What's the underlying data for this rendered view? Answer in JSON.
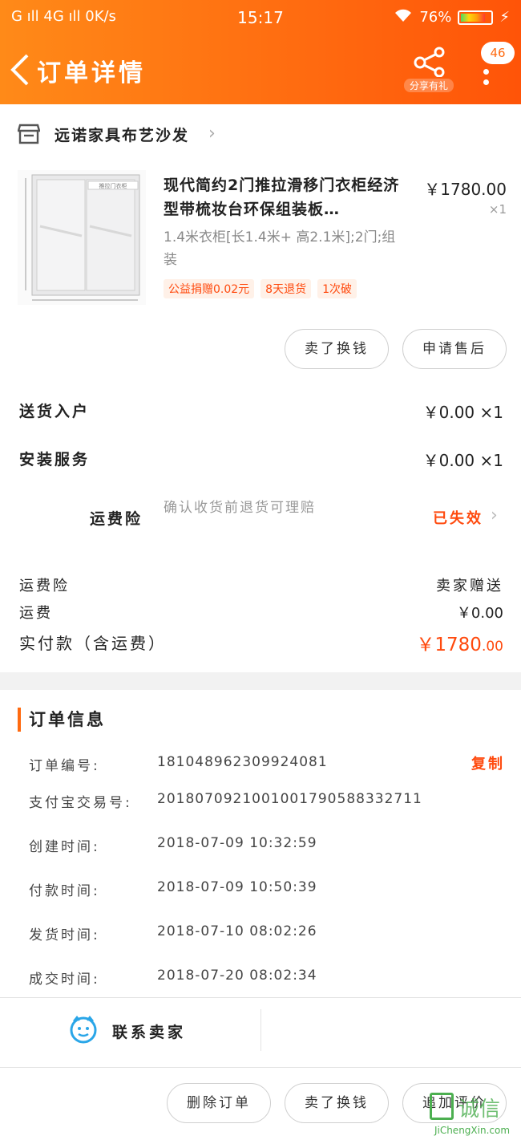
{
  "status_bar": {
    "left": "G ıll 4G ıll 0K/s",
    "time": "15:17",
    "battery": "76%"
  },
  "nav": {
    "title": "订单详情",
    "share_label": "分享有礼",
    "message_count": "46"
  },
  "shop": {
    "name": "远诺家具布艺沙发",
    "chevron": "›"
  },
  "product": {
    "title": "现代简约2门推拉滑移门衣柜经济型带梳妆台环保组装板…",
    "price": "￥1780.00",
    "qty": "×1",
    "spec": "1.4米衣柜[长1.4米+ 高2.1米];2门;组装",
    "tags": [
      "公益捐赠0.02元",
      "8天退货",
      "1次破"
    ],
    "image_caption": "推拉门衣柜"
  },
  "item_buttons": {
    "sell": "卖了换钱",
    "after_sale": "申请售后"
  },
  "services": [
    {
      "name": "送货入户",
      "value": "￥0.00 ×1"
    },
    {
      "name": "安装服务",
      "value": "￥0.00 ×1"
    }
  ],
  "insurance": {
    "name": "运费险",
    "desc": "确认收货前退货可理赔",
    "status": "已失效",
    "chevron": "›"
  },
  "summary": {
    "insurance_label": "运费险",
    "insurance_value": "卖家赠送",
    "shipping_label": "运费",
    "shipping_value": "￥0.00",
    "paid_label": "实付款（含运费）",
    "paid_value_main": "￥1780",
    "paid_value_cents": ".00"
  },
  "order_info": {
    "heading": "订单信息",
    "copy_label": "复制",
    "rows": [
      {
        "label": "订单编号:",
        "value": "181048962309924081"
      },
      {
        "label": "支付宝交易号:",
        "value": "2018070921001001790588332711"
      },
      {
        "label": "创建时间:",
        "value": "2018-07-09 10:32:59"
      },
      {
        "label": "付款时间:",
        "value": "2018-07-09 10:50:39"
      },
      {
        "label": "发货时间:",
        "value": "2018-07-10 08:02:26"
      },
      {
        "label": "成交时间:",
        "value": "2018-07-20 08:02:34"
      }
    ]
  },
  "contact": {
    "label": "联系卖家"
  },
  "bottom_buttons": {
    "delete": "删除订单",
    "sell": "卖了换钱",
    "review": "追加评价"
  },
  "watermark": {
    "text": "诚信",
    "url": "JiChengXin.com"
  },
  "colors": {
    "brand": "#ff6a10",
    "accent_text": "#ff4a0e",
    "contact_icon": "#2aa6e8",
    "watermark": "#4caf50"
  }
}
